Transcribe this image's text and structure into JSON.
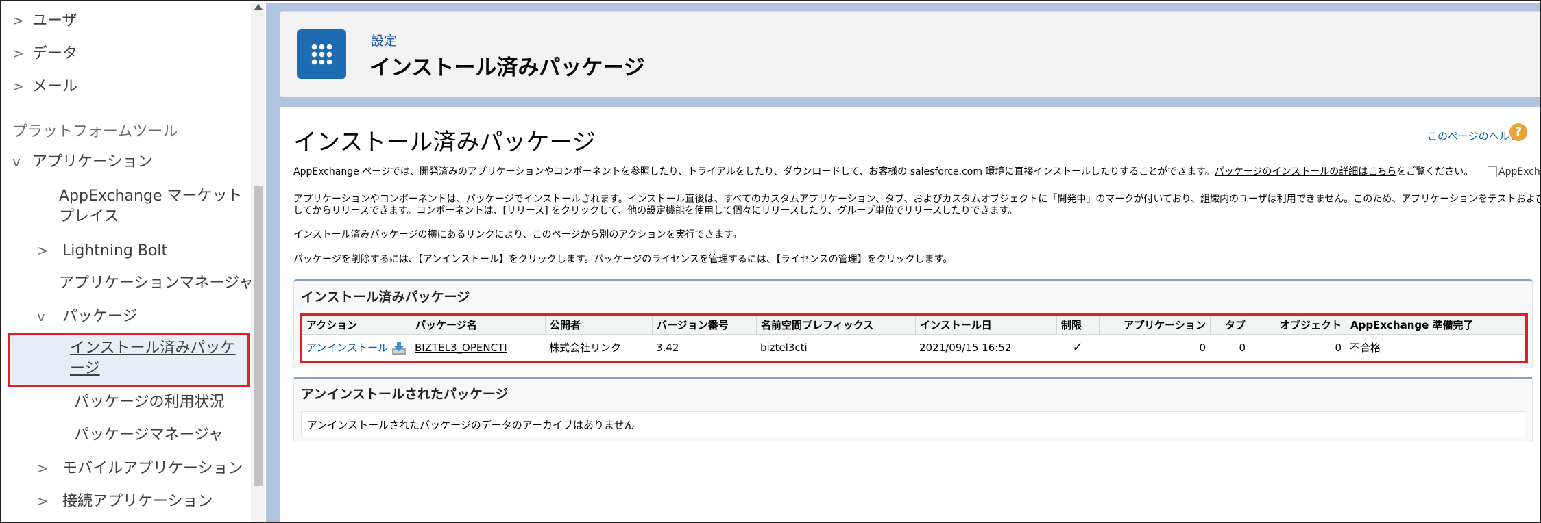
{
  "sidebar": {
    "items": [
      {
        "label": "ユーザ",
        "chevron": ">"
      },
      {
        "label": "データ",
        "chevron": ">"
      },
      {
        "label": "メール",
        "chevron": ">"
      }
    ],
    "section_header": "プラットフォームツール",
    "applications": {
      "label": "アプリケーション",
      "chevron": "v"
    },
    "app_children": [
      {
        "label": "AppExchange マーケットプレイス"
      },
      {
        "label": "Lightning Bolt",
        "chevron": ">"
      },
      {
        "label": "アプリケーションマネージャ"
      }
    ],
    "packages": {
      "label": "パッケージ",
      "chevron": "v"
    },
    "package_children": [
      {
        "label": "インストール済みパッケージ",
        "selected": true
      },
      {
        "label": "パッケージの利用状況"
      },
      {
        "label": "パッケージマネージャ"
      }
    ],
    "bottom_items": [
      {
        "label": "モバイルアプリケーション",
        "chevron": ">"
      },
      {
        "label": "接続アプリケーション",
        "chevron": ">"
      }
    ]
  },
  "header": {
    "icon": "app-grid-icon",
    "subtitle": "設定",
    "title": "インストール済みパッケージ"
  },
  "content": {
    "title": "インストール済みパッケージ",
    "help_link": "このページのヘルプ",
    "help_icon": "question-icon",
    "para1_a": "AppExchange ページでは、開発済みのアプリケーションやコンポーネントを参照したり、トライアルをしたり、ダウンロードして、お客様の salesforce.com 環境に直接インストールしたりすることができます。",
    "para1_link": "パッケージのインストールの詳細はこちら",
    "para1_b": "をご覧ください。",
    "appexchange_img_alt": "AppExchange へ",
    "para2_line1": "アプリケーションやコンポーネントは、パッケージでインストールされます。インストール直後は、すべてのカスタムアプリケーション、タブ、およびカスタムオブジェクトに「開発中」のマークが付いており、組織内のユーザは利用できません。このため、アプリケーションをテストおよびカスタマイズ",
    "para2_line2": "してからリリースできます。コンポーネントは、[リリース] をクリックして、他の設定機能を使用して個々にリリースしたり、グループ単位でリリースしたりできます。",
    "para3": "インストール済みパッケージの横にあるリンクにより、このページから別のアクションを実行できます。",
    "para4": "パッケージを削除するには、【アンインストール】をクリックします。パッケージのライセンスを管理するには、【ライセンスの管理】をクリックします。"
  },
  "installed_section": {
    "title": "インストール済みパッケージ",
    "columns": [
      "アクション",
      "パッケージ名",
      "公開者",
      "バージョン番号",
      "名前空間プレフィックス",
      "インストール日",
      "制限",
      "アプリケーション",
      "タブ",
      "オブジェクト",
      "AppExchange 準備完了"
    ],
    "rows": [
      {
        "action": "アンインストール",
        "action_icon": "download-icon",
        "package_name": "BIZTEL3_OPENCTI",
        "publisher": "株式会社リンク",
        "version": "3.42",
        "namespace": "biztel3cti",
        "install_date": "2021/09/15 16:52",
        "restricted": "✓",
        "apps": "0",
        "tabs": "0",
        "objects": "0",
        "appexchange_ready": "不合格"
      }
    ]
  },
  "uninstalled_section": {
    "title": "アンインストールされたパッケージ",
    "empty_message": "アンインストールされたパッケージのデータのアーカイブはありません"
  }
}
